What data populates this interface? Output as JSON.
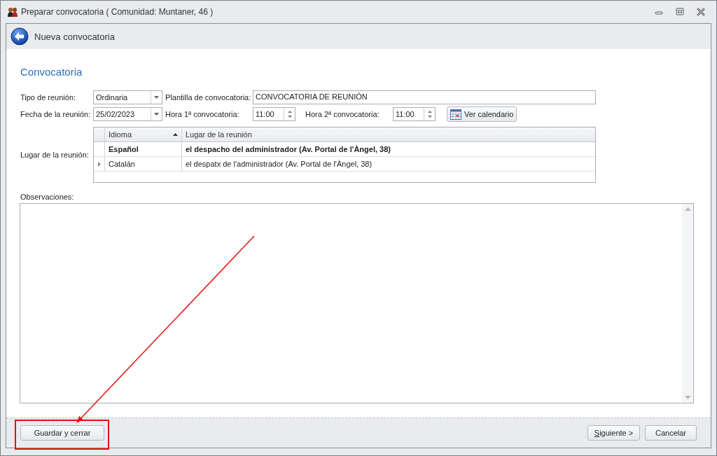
{
  "window": {
    "title": "Preparar convocatoria ( Comunidad: Muntaner, 46 )"
  },
  "header": {
    "title": "Nueva convocatoria"
  },
  "section_title": "Convocatoria",
  "form": {
    "meeting_type": {
      "label": "Tipo de reunión:",
      "value": "Ordinaria"
    },
    "template": {
      "label": "Plantilla de convocatoria:",
      "value": "CONVOCATORIA DE REUNIÓN"
    },
    "date": {
      "label": "Fecha de la reunión:",
      "value": "25/02/2023"
    },
    "time_first": {
      "label": "Hora 1ª convocatoria:",
      "value": "11:00"
    },
    "time_second": {
      "label": "Hora 2ª convocatoria:",
      "value": "11:00"
    },
    "calendar_button": "Ver calendario",
    "place_label": "Lugar de la reunión:"
  },
  "grid": {
    "columns": [
      {
        "label": "Idioma",
        "sorted": true
      },
      {
        "label": "Lugar de la reunión",
        "sorted": false
      }
    ],
    "rows": [
      {
        "cells": [
          "Español",
          "el despacho del administrador (Av. Portal de l'Àngel, 38)"
        ],
        "bold": true,
        "selected": false
      },
      {
        "cells": [
          "Catalán",
          "el despatx de l'administrador (Av. Portal de l'Àngel, 38)"
        ],
        "bold": false,
        "selected": true
      }
    ]
  },
  "notes": {
    "label": "Observaciones:"
  },
  "footer": {
    "save_button": "Guardar y cerrar",
    "next_button": "Siguiente >",
    "cancel_button": "Cancelar"
  },
  "annotation": {
    "highlight_save": true
  }
}
